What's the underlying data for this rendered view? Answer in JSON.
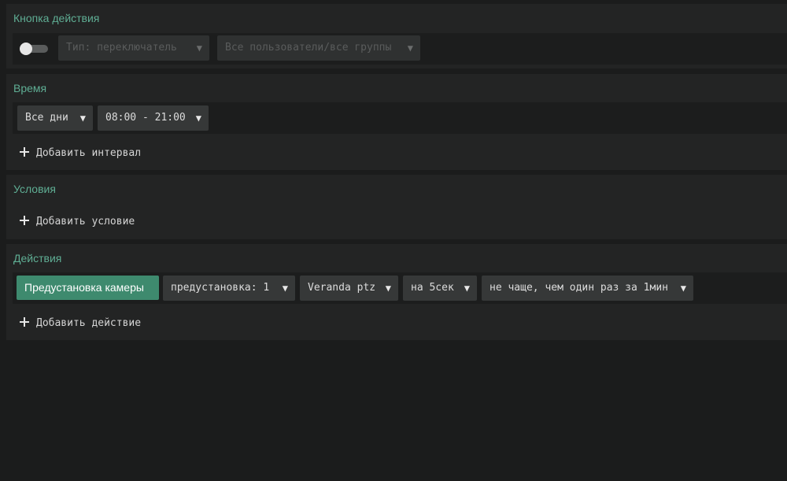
{
  "sections": {
    "button": {
      "title": "Кнопка действия",
      "toggle": {
        "on": false
      },
      "type_dropdown": "Тип: переключатель",
      "users_dropdown": "Все пользователи/все группы"
    },
    "time": {
      "title": "Время",
      "days_dropdown": "Все дни",
      "interval_dropdown": "08:00 - 21:00",
      "add_label": "Добавить интервал"
    },
    "conditions": {
      "title": "Условия",
      "add_label": "Добавить условие"
    },
    "actions": {
      "title": "Действия",
      "action_button": "Предустановка камеры",
      "preset_dropdown": "предустановка: 1",
      "camera_dropdown": "Veranda ptz",
      "duration_dropdown": "на 5сек",
      "frequency_dropdown": "не чаще, чем один раз за 1мин",
      "add_label": "Добавить действие"
    }
  },
  "icons": {
    "dropdown_arrow": "caret-down-icon",
    "add": "plus-icon"
  },
  "colors": {
    "accent": "#5fae94",
    "action_button": "#3e8a6e",
    "background": "#1b1c1c",
    "panel": "#232424"
  }
}
